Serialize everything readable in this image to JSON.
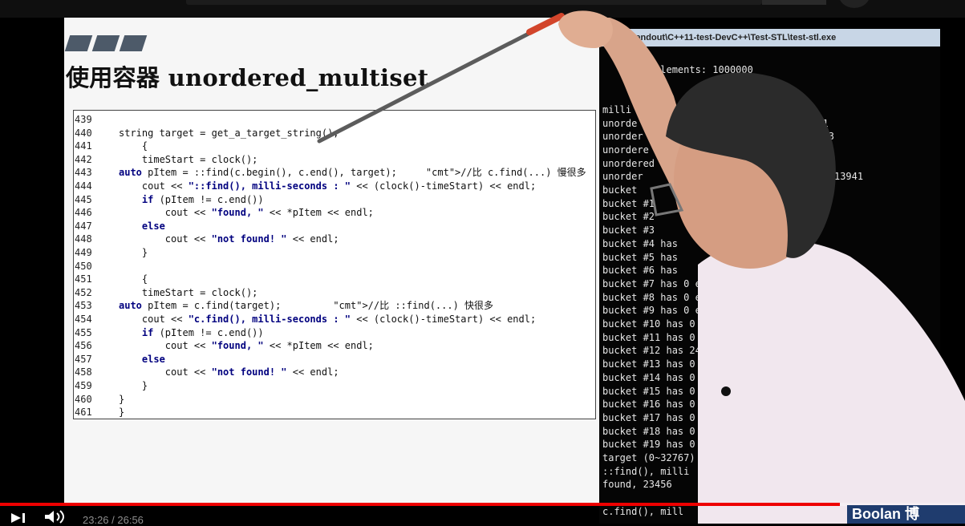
{
  "slide": {
    "title": "使用容器 unordered_multiset",
    "code_lines": [
      {
        "num": "439",
        "code": ""
      },
      {
        "num": "440",
        "code": "string target = get_a_target_string();"
      },
      {
        "num": "441",
        "code": "    {"
      },
      {
        "num": "442",
        "code": "    timeStart = clock();"
      },
      {
        "num": "443",
        "code": "auto pItem = ::find(c.begin(), c.end(), target);     //比 c.find(...) 慢很多"
      },
      {
        "num": "444",
        "code": "    cout << \"::find(), milli-seconds : \" << (clock()-timeStart) << endl;"
      },
      {
        "num": "445",
        "code": "    if (pItem != c.end())"
      },
      {
        "num": "446",
        "code": "        cout << \"found, \" << *pItem << endl;"
      },
      {
        "num": "447",
        "code": "    else"
      },
      {
        "num": "448",
        "code": "        cout << \"not found! \" << endl;"
      },
      {
        "num": "449",
        "code": "    }"
      },
      {
        "num": "450",
        "code": ""
      },
      {
        "num": "451",
        "code": "    {"
      },
      {
        "num": "452",
        "code": "    timeStart = clock();"
      },
      {
        "num": "453",
        "code": "auto pItem = c.find(target);         //比 ::find(...) 快很多"
      },
      {
        "num": "454",
        "code": "    cout << \"c.find(), milli-seconds : \" << (clock()-timeStart) << endl;"
      },
      {
        "num": "455",
        "code": "    if (pItem != c.end())"
      },
      {
        "num": "456",
        "code": "        cout << \"found, \" << *pItem << endl;"
      },
      {
        "num": "457",
        "code": "    else"
      },
      {
        "num": "458",
        "code": "        cout << \"not found! \" << endl;"
      },
      {
        "num": "459",
        "code": "    }"
      },
      {
        "num": "460",
        "code": "}"
      },
      {
        "num": "461",
        "code": "}"
      }
    ]
  },
  "console": {
    "title": ":\\handout\\C++11-test-DevC++\\Test-STL\\test-stl.exe",
    "lines": [
      "  ct: 8",
      "     any elements: 1000000",
      "",
      "",
      "milli",
      "unorde                              941",
      "unorder                             6323",
      "unordere                            668",
      "unordered                           1",
      "unorder                           = 357913941",
      "bucket",
      "bucket #1",
      "bucket #2",
      "bucket #3",
      "bucket #4 has",
      "bucket #5 has",
      "bucket #6 has",
      "bucket #7 has 0 el",
      "bucket #8 has 0 elem",
      "bucket #9 has 0 elem",
      "bucket #10 has 0 ele",
      "bucket #11 has 0 ele",
      "bucket #12 has 24 el",
      "bucket #13 has 0 el",
      "bucket #14 has 0 e",
      "bucket #15 has 0 e",
      "bucket #16 has 0 e",
      "bucket #17 has 0",
      "bucket #18 has 0",
      "bucket #19 has 0",
      "target (0~32767)",
      "::find(), milli",
      "found, 23456",
      "",
      "c.find(), mill"
    ]
  },
  "player": {
    "time": "23:26 / 26:56",
    "progress": 0.87,
    "buffered": 0.75,
    "brand": "Boolan 博"
  }
}
